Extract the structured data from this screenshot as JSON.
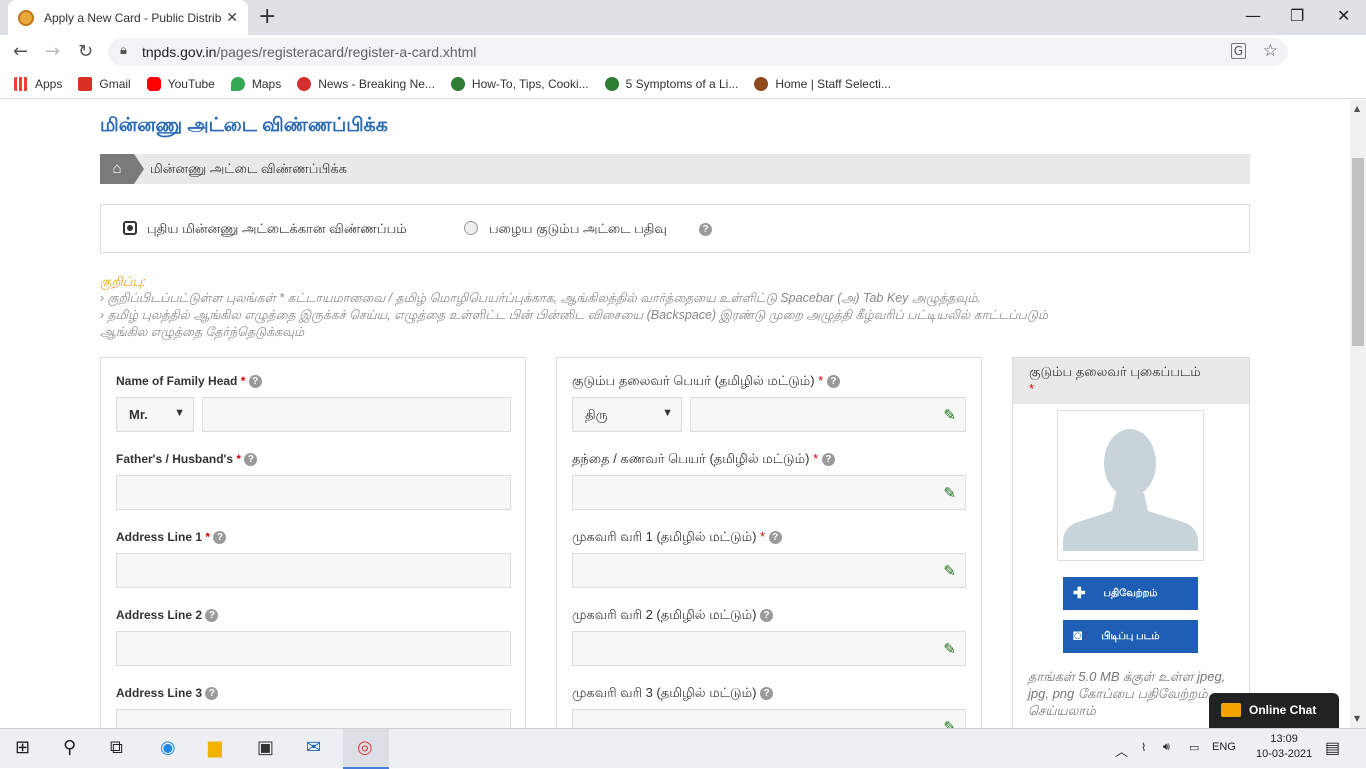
{
  "browser": {
    "tab_title": "Apply a New Card - Public Distrib",
    "url_host": "tnpds.gov.in",
    "url_path": "/pages/registeracard/register-a-card.xhtml",
    "bookmarks": [
      {
        "label": "Apps",
        "color": "#e94235"
      },
      {
        "label": "Gmail",
        "color": "#d93025"
      },
      {
        "label": "YouTube",
        "color": "#ff0000"
      },
      {
        "label": "Maps",
        "color": "#34a853"
      },
      {
        "label": "News - Breaking Ne...",
        "color": "#d32f2f"
      },
      {
        "label": "How-To, Tips, Cooki...",
        "color": "#2e7d32"
      },
      {
        "label": "5 Symptoms of a Li...",
        "color": "#2e7d32"
      },
      {
        "label": "Home | Staff Selecti...",
        "color": "#8d4a1f"
      }
    ]
  },
  "page": {
    "title": "மின்னணு அட்டை விண்ணப்பிக்க",
    "breadcrumb": "மின்னணு அட்டை விண்ணப்பிக்க",
    "radio_new": "புதிய மின்னணு அட்டைக்கான விண்ணப்பம்",
    "radio_old": "பழைய குடும்ப அட்டை பதிவு",
    "note_heading": "குறிப்பு:",
    "note_1": "› குறிப்பிடப்பட்டுள்ள புலங்கள்  *  கட்டாயமானவை  /  தமிழ் மொழிபெயர்ப்புக்காக, ஆங்கிலத்தில் வார்த்தையை உள்ளிட்டு Spacebar (அ) Tab Key அழுத்தவும்.",
    "note_2": "› தமிழ் புலத்தில் ஆங்கில எழுத்தை இருக்கச் செய்ய, எழுத்தை உள்ளிட்ட பின் பின்னிட விசையை (Backspace) இரண்டு முறை அழுத்தி கீழ்வரிப் பட்டியலில் காட்டப்படும்",
    "note_3": "ஆங்கில எழுத்தை தேர்ந்தெடுக்கவும்",
    "en_fields": {
      "family_head": "Name of Family Head",
      "father": "Father's / Husband's",
      "addr1": "Address Line 1",
      "addr2": "Address Line 2",
      "addr3": "Address Line 3",
      "title_select": "Mr."
    },
    "ta_fields": {
      "family_head": "குடும்ப தலைவர் பெயர் (தமிழில் மட்டும்)",
      "father": "தந்தை / கணவர் பெயர் (தமிழில் மட்டும்)",
      "addr1": "முகவரி வரி 1 (தமிழில் மட்டும்)",
      "addr2": "முகவரி வரி 2 (தமிழில் மட்டும்)",
      "addr3": "முகவரி வரி 3 (தமிழில் மட்டும்)",
      "title_select": "திரு"
    },
    "photo": {
      "heading": "குடும்ப தலைவர் புகைப்படம்",
      "upload": "பதிவேற்றம்",
      "capture": "பிடிப்பு படம்",
      "note": "தாங்கள் 5.0 MB க்குள் உள்ள jpeg, jpg, png கோப்பை பதிவேற்றம் செய்யலாம்"
    },
    "chat": "Online Chat",
    "required_mark": "*",
    "help_mark": "?"
  },
  "taskbar": {
    "lang": "ENG",
    "time": "13:09",
    "date": "10-03-2021"
  }
}
